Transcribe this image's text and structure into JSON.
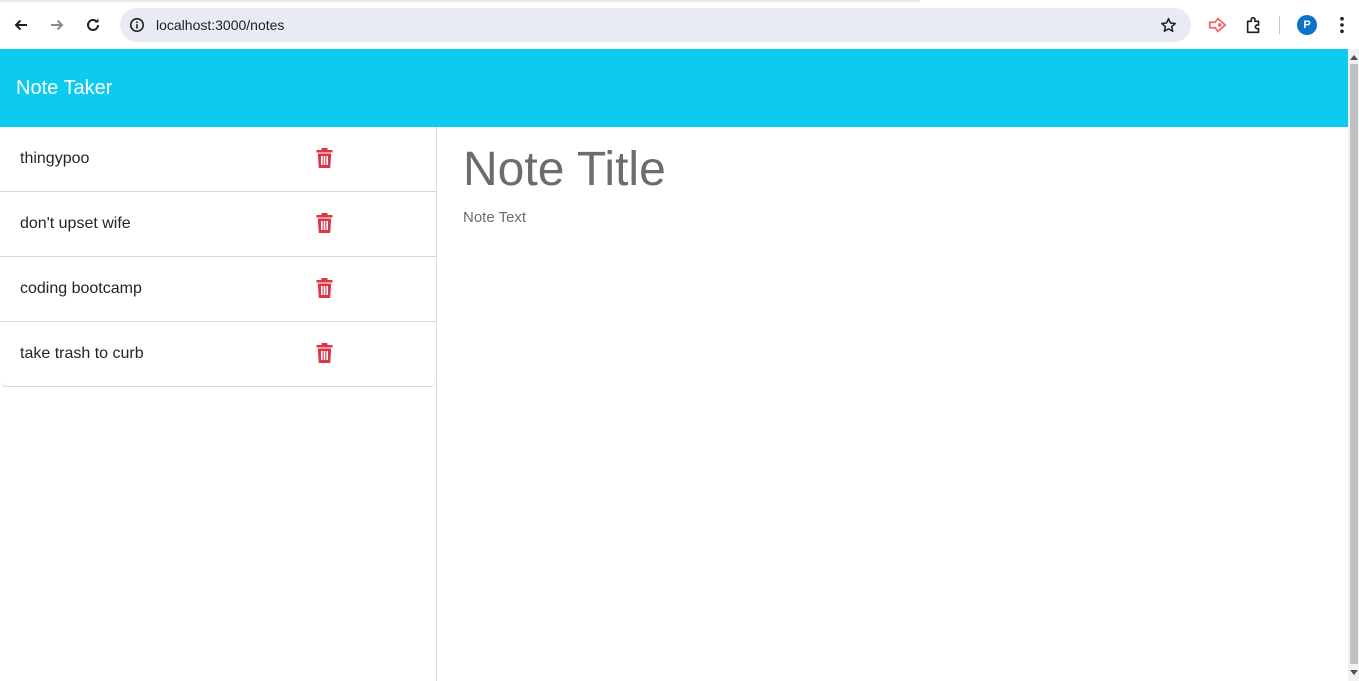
{
  "browser": {
    "url": "localhost:3000/notes",
    "profile_initial": "P"
  },
  "app": {
    "title": "Note Taker"
  },
  "notes": [
    {
      "label": "thingypoo"
    },
    {
      "label": "don't upset wife"
    },
    {
      "label": "coding bootcamp"
    },
    {
      "label": "take trash to curb"
    }
  ],
  "editor": {
    "title_placeholder": "Note Title",
    "text_placeholder": "Note Text"
  },
  "colors": {
    "header": "#0dcaf0",
    "delete": "#dc3545"
  },
  "icons": {
    "back": "arrow-left-icon",
    "forward": "arrow-right-icon",
    "reload": "reload-icon",
    "site_info": "info-icon",
    "bookmark": "star-icon",
    "extension": "extension-icon",
    "extensions_menu": "puzzle-icon",
    "menu": "kebab-menu-icon",
    "delete": "trash-icon"
  }
}
